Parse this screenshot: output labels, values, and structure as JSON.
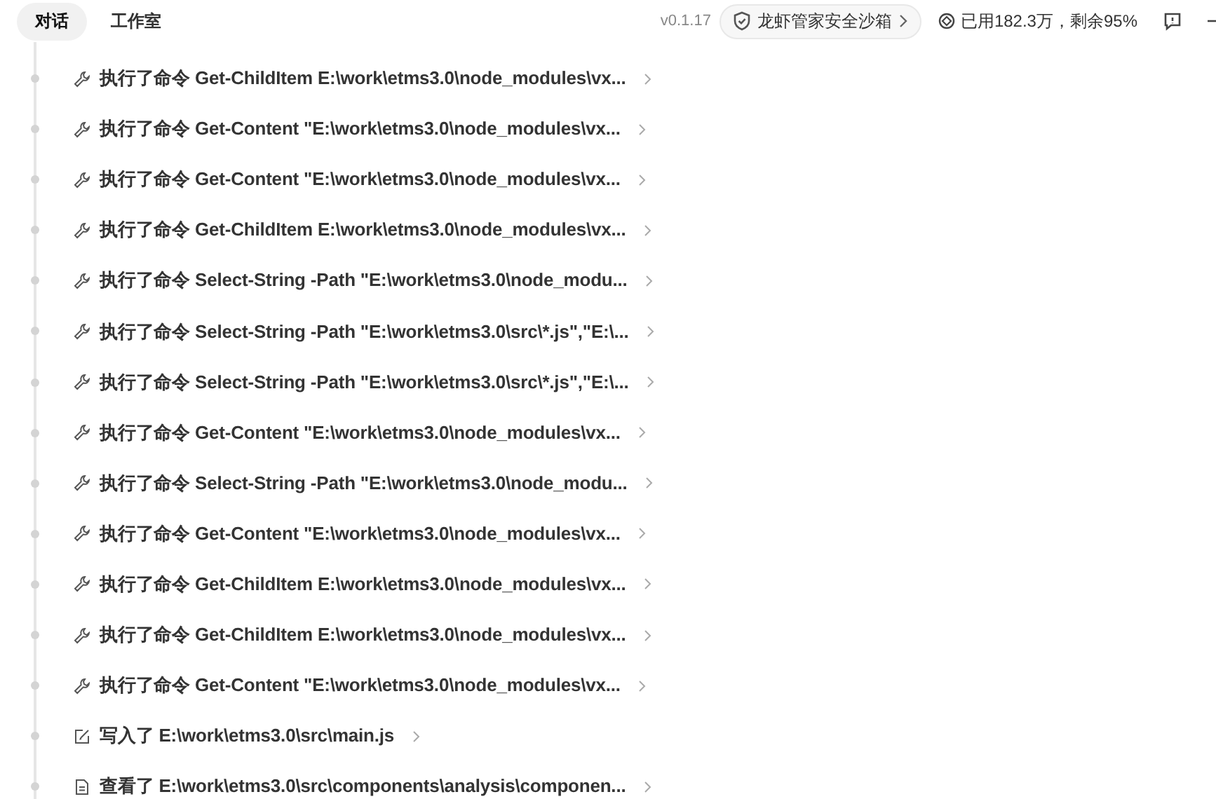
{
  "tabs": [
    {
      "label": "对话",
      "selected": true
    },
    {
      "label": "工作室",
      "selected": false
    }
  ],
  "version": "v0.1.17",
  "sandbox_button": "龙虾管家安全沙箱",
  "usage": "已用182.3万，剩余95%",
  "steps": [
    {
      "kind": "command",
      "text": "执行了命令 Get-ChildItem E:\\work\\etms3.0\\node_modules\\vx..."
    },
    {
      "kind": "command",
      "text": "执行了命令 Get-Content \"E:\\work\\etms3.0\\node_modules\\vx..."
    },
    {
      "kind": "command",
      "text": "执行了命令 Get-Content \"E:\\work\\etms3.0\\node_modules\\vx..."
    },
    {
      "kind": "command",
      "text": "执行了命令 Get-ChildItem E:\\work\\etms3.0\\node_modules\\vx..."
    },
    {
      "kind": "command",
      "text": "执行了命令 Select-String -Path \"E:\\work\\etms3.0\\node_modu..."
    },
    {
      "kind": "command",
      "text": "执行了命令 Select-String -Path \"E:\\work\\etms3.0\\src\\*.js\",\"E:\\..."
    },
    {
      "kind": "command",
      "text": "执行了命令 Select-String -Path \"E:\\work\\etms3.0\\src\\*.js\",\"E:\\..."
    },
    {
      "kind": "command",
      "text": "执行了命令 Get-Content \"E:\\work\\etms3.0\\node_modules\\vx..."
    },
    {
      "kind": "command",
      "text": "执行了命令 Select-String -Path \"E:\\work\\etms3.0\\node_modu..."
    },
    {
      "kind": "command",
      "text": "执行了命令 Get-Content \"E:\\work\\etms3.0\\node_modules\\vx..."
    },
    {
      "kind": "command",
      "text": "执行了命令 Get-ChildItem E:\\work\\etms3.0\\node_modules\\vx..."
    },
    {
      "kind": "command",
      "text": "执行了命令 Get-ChildItem E:\\work\\etms3.0\\node_modules\\vx..."
    },
    {
      "kind": "command",
      "text": "执行了命令 Get-Content \"E:\\work\\etms3.0\\node_modules\\vx..."
    },
    {
      "kind": "write",
      "text": "写入了 E:\\work\\etms3.0\\src\\main.js"
    },
    {
      "kind": "read",
      "text": "查看了 E:\\work\\etms3.0\\src\\components\\analysis\\componen..."
    }
  ]
}
